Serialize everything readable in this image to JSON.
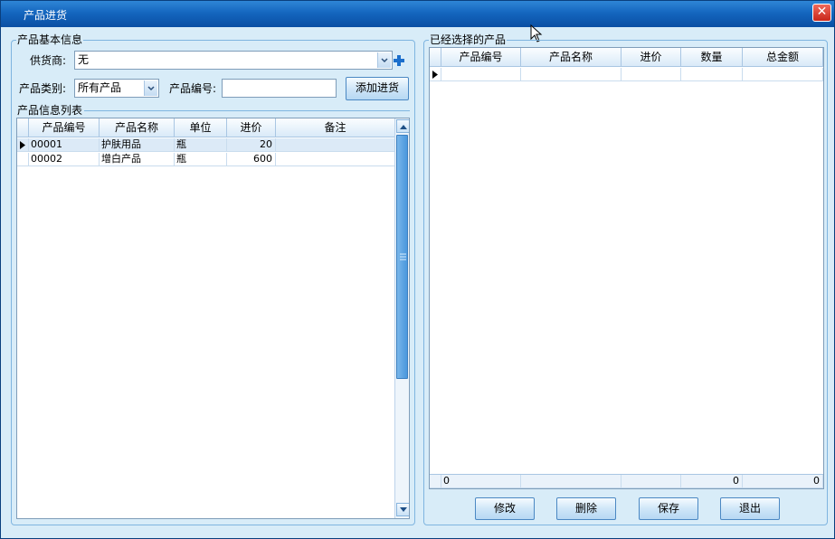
{
  "window": {
    "title": "产品进货",
    "close_glyph": "✕"
  },
  "product_info": {
    "legend": "产品基本信息",
    "supplier_label": "供货商:",
    "supplier_value": "无",
    "category_label": "产品类别:",
    "category_value": "所有产品",
    "code_label": "产品编号:",
    "code_value": "",
    "add_button": "添加进货",
    "add_supplier_icon": "plus-icon"
  },
  "product_list": {
    "legend": "产品信息列表",
    "columns": [
      "产品编号",
      "产品名称",
      "单位",
      "进价",
      "备注"
    ],
    "rows": [
      {
        "code": "00001",
        "name": "护肤用品",
        "unit": "瓶",
        "price": "20",
        "note": ""
      },
      {
        "code": "00002",
        "name": "增白产品",
        "unit": "瓶",
        "price": "600",
        "note": ""
      }
    ]
  },
  "selected": {
    "legend": "已经选择的产品",
    "columns": [
      "产品编号",
      "产品名称",
      "进价",
      "数量",
      "总金额"
    ],
    "footer": {
      "code": "0",
      "name": "",
      "price": "",
      "qty": "0",
      "total": "0"
    }
  },
  "actions": {
    "edit": "修改",
    "delete": "删除",
    "save": "保存",
    "exit": "退出"
  },
  "colors": {
    "title_bar": "#1466bf",
    "panel_bg": "#d8ecf8",
    "close_red": "#c8261a"
  }
}
